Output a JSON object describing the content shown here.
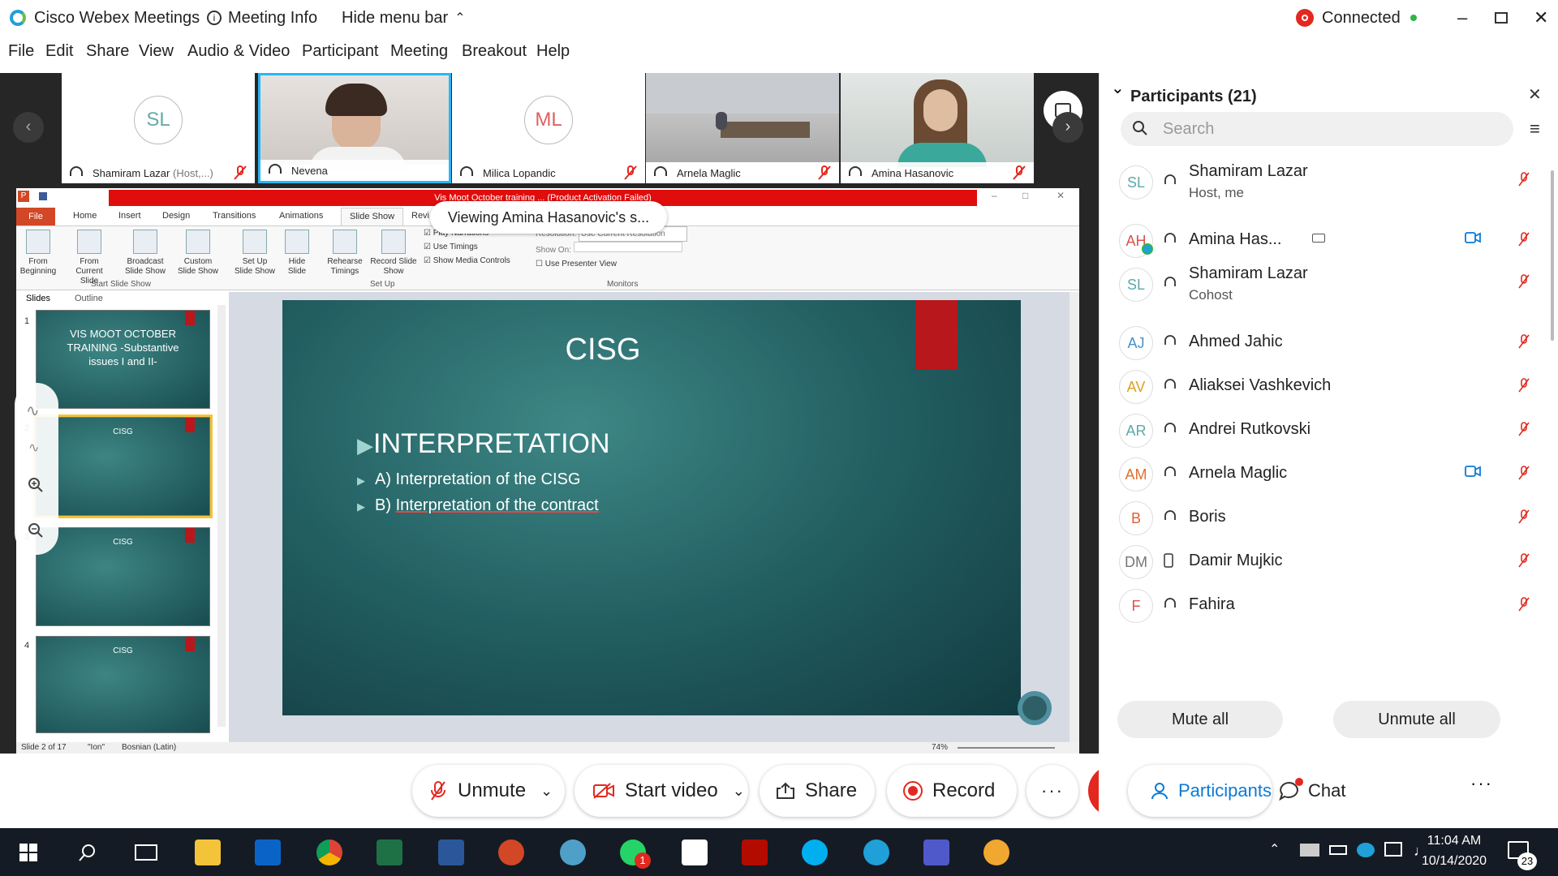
{
  "titlebar": {
    "app_name": "Cisco Webex Meetings",
    "meeting_info": "Meeting Info",
    "hide_menu": "Hide menu bar",
    "connected": "Connected"
  },
  "menu": [
    "File",
    "Edit",
    "Share",
    "View",
    "Audio & Video",
    "Participant",
    "Meeting",
    "Breakout",
    "Help"
  ],
  "filmstrip": [
    {
      "name": "Shamiram Lazar",
      "role": "(Host,...)",
      "initials": "SL",
      "type": "avatar"
    },
    {
      "name": "Nevena",
      "role": "",
      "initials": "",
      "type": "video"
    },
    {
      "name": "Milica Lopandic",
      "role": "",
      "initials": "ML",
      "type": "avatar"
    },
    {
      "name": "Arnela Maglic",
      "role": "",
      "initials": "",
      "type": "video"
    },
    {
      "name": "Amina Hasanovic",
      "role": "",
      "initials": "",
      "type": "video"
    }
  ],
  "viewing_label": "Viewing Amina Hasanovic's s...",
  "powerpoint": {
    "window_title": "Vis Moot October training ... (Product Activation Failed)",
    "tabs": [
      "File",
      "Home",
      "Insert",
      "Design",
      "Transitions",
      "Animations",
      "Slide Show",
      "Revi"
    ],
    "ribbon": {
      "from_beginning": "From Beginning",
      "from_current": "From Current Slide",
      "broadcast": "Broadcast Slide Show",
      "custom": "Custom Slide Show",
      "group_start": "Start Slide Show",
      "setup": "Set Up Slide Show",
      "hide": "Hide Slide",
      "rehearse": "Rehearse Timings",
      "record": "Record Slide Show",
      "play_narrations": "Play Narrations",
      "use_timings": "Use Timings",
      "show_media": "Show Media Controls",
      "group_setup": "Set Up",
      "resolution_label": "Resolution:",
      "resolution_value": "Use Current Resolution",
      "show_on": "Show On:",
      "presenter_view": "Use Presenter View",
      "group_monitors": "Monitors"
    },
    "pane_tabs": [
      "Slides",
      "Outline"
    ],
    "thumbs": [
      {
        "num": "1",
        "title": "VIS MOOT OCTOBER TRAINING -Substantive issues I and II-"
      },
      {
        "num": "2",
        "title": "CISG"
      },
      {
        "num": "3",
        "title": "CISG"
      },
      {
        "num": "4",
        "title": "CISG"
      }
    ],
    "slide": {
      "title": "CISG",
      "heading": "INTERPRETATION",
      "bullet_a": "A) Interpretation of the CISG",
      "bullet_b_prefix": "B) ",
      "bullet_b": "Interpretation of the contract"
    },
    "status": {
      "slide": "Slide 2 of 17",
      "theme": "\"Ion\"",
      "lang": "Bosnian (Latin)",
      "zoom": "74%"
    }
  },
  "controls": {
    "unmute": "Unmute",
    "start_video": "Start video",
    "share": "Share",
    "record": "Record",
    "participants": "Participants",
    "chat": "Chat"
  },
  "participants_panel": {
    "title": "Participants (21)",
    "search_placeholder": "Search",
    "mute_all": "Mute all",
    "unmute_all": "Unmute all",
    "list": [
      {
        "initials": "SL",
        "name": "Shamiram Lazar",
        "sub": "Host, me",
        "color": "#5fa8a8",
        "video": false,
        "device": "headset"
      },
      {
        "initials": "AH",
        "name": "Amina Has...",
        "sub": "",
        "color": "#d9534f",
        "video": true,
        "device": "headset"
      },
      {
        "initials": "SL",
        "name": "Shamiram Lazar",
        "sub": "Cohost",
        "color": "#5fa8a8",
        "video": false,
        "device": "headset"
      },
      {
        "initials": "AJ",
        "name": "Ahmed Jahic",
        "sub": "",
        "color": "#4a90c8",
        "video": false,
        "device": "headset"
      },
      {
        "initials": "AV",
        "name": "Aliaksei Vashkevich",
        "sub": "",
        "color": "#e0a020",
        "video": false,
        "device": "headset"
      },
      {
        "initials": "AR",
        "name": "Andrei Rutkovski",
        "sub": "",
        "color": "#5fa8a8",
        "video": false,
        "device": "headset"
      },
      {
        "initials": "AM",
        "name": "Arnela Maglic",
        "sub": "",
        "color": "#e07030",
        "video": true,
        "device": "headset"
      },
      {
        "initials": "B",
        "name": "Boris",
        "sub": "",
        "color": "#e06030",
        "video": false,
        "device": "headset"
      },
      {
        "initials": "DM",
        "name": "Damir Mujkic",
        "sub": "",
        "color": "#777777",
        "video": false,
        "device": "phone"
      },
      {
        "initials": "F",
        "name": "Fahira",
        "sub": "",
        "color": "#d9534f",
        "video": false,
        "device": "headset"
      }
    ]
  },
  "taskbar": {
    "time": "11:04 AM",
    "date": "10/14/2020",
    "notif": "23",
    "whatsapp_badge": "1"
  },
  "colors": {
    "accent": "#0a7ad6",
    "red": "#e2281f",
    "connected_green": "#2fb44a",
    "slide_red": "#b8171b"
  }
}
